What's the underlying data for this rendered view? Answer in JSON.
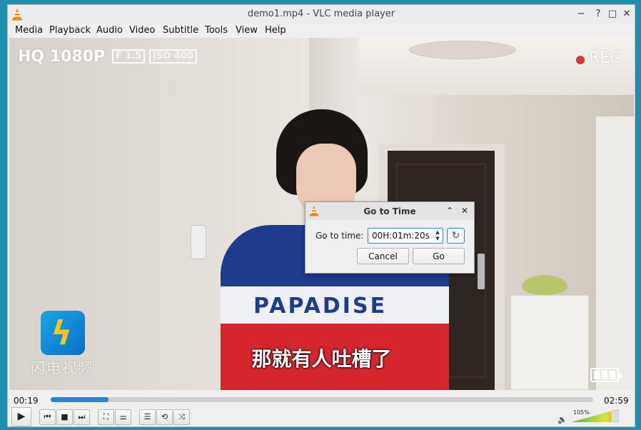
{
  "window": {
    "title": "demo1.mp4 - VLC media player",
    "controls": {
      "minimize": "−",
      "help": "?",
      "maximize": "□",
      "close": "✕"
    }
  },
  "menu": [
    "Media",
    "Playback",
    "Audio",
    "Video",
    "Subtitle",
    "Tools",
    "View",
    "Help"
  ],
  "video": {
    "overlay_quality": "HQ 1080P",
    "overlay_aperture": "F 1.5",
    "overlay_iso": "ISO 400",
    "overlay_rec": "REC",
    "shirt_text": "PAPADISE",
    "subtitle": "那就有人吐槽了",
    "channel_name": "闪电视频"
  },
  "dialog": {
    "title": "Go to Time",
    "label": "Go to time:",
    "time_value": "00H:01m:20s",
    "cancel_label": "Cancel",
    "go_label": "Go",
    "reset_icon": "↻"
  },
  "playback": {
    "elapsed": "00:19",
    "total": "02:59",
    "progress_fraction": 0.106
  },
  "controls": {
    "play": "▶",
    "prev": "⏮",
    "stop": "■",
    "next": "⏭",
    "fullscreen": "⛶",
    "extended": "⚌",
    "playlist": "☰",
    "loop": "⟲",
    "shuffle": "⤨"
  },
  "volume": {
    "label": "105%",
    "level_percent": 105,
    "icon": "🔈"
  },
  "colors": {
    "accent": "#2f7ed8",
    "vlc_orange": "#f08a00",
    "volume_green": "#3fbf3f"
  }
}
